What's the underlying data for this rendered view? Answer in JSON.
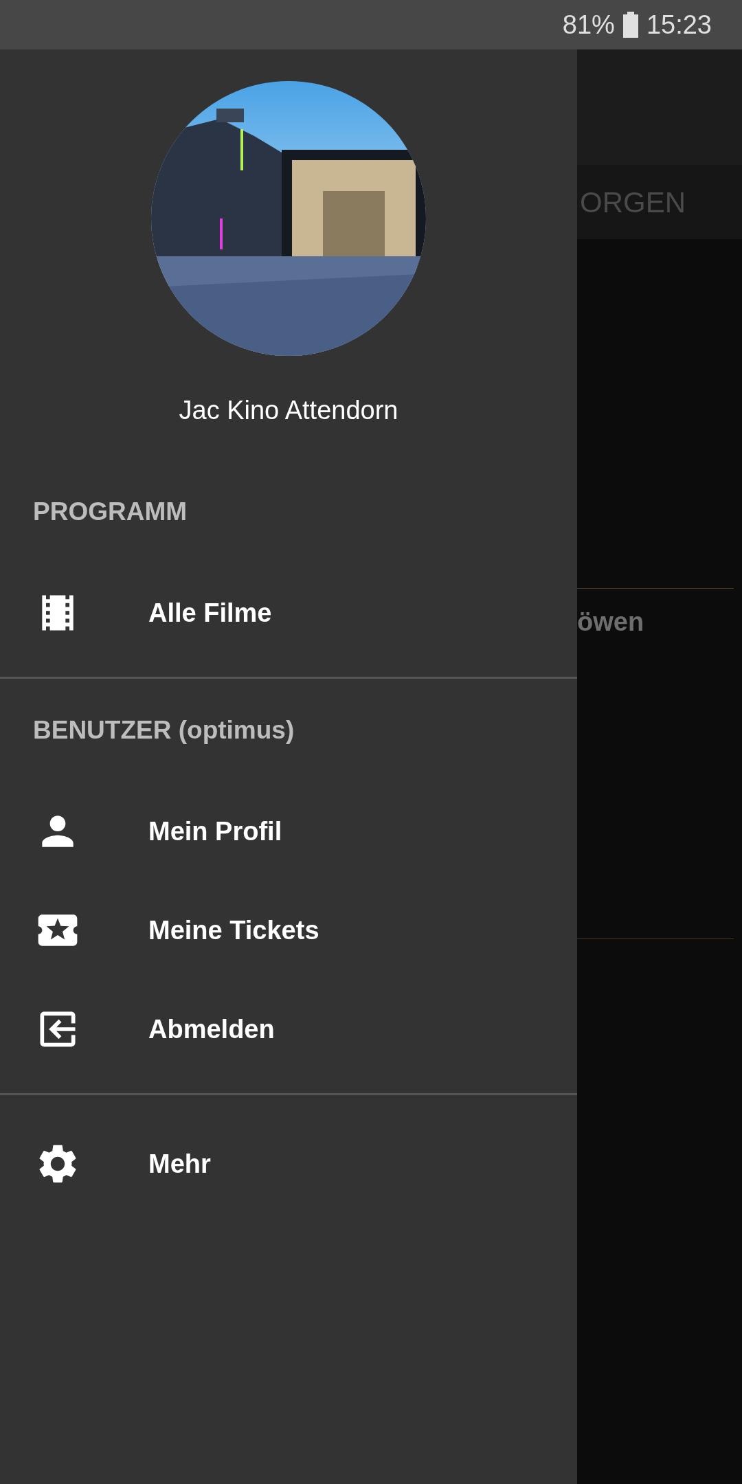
{
  "status_bar": {
    "battery": "81%",
    "time": "15:23"
  },
  "background": {
    "tab": "ORGEN",
    "rows": [
      {
        "title": "öwen"
      }
    ]
  },
  "drawer": {
    "header": {
      "name": "Jac Kino Attendorn"
    },
    "sections": [
      {
        "title": "PROGRAMM",
        "items": [
          {
            "label": "Alle Filme",
            "kind": "film"
          }
        ]
      },
      {
        "title": "BENUTZER (optimus)",
        "items": [
          {
            "label": "Mein Profil",
            "kind": "person"
          },
          {
            "label": "Meine Tickets",
            "kind": "ticket"
          },
          {
            "label": "Abmelden",
            "kind": "logout"
          }
        ]
      },
      {
        "items": [
          {
            "label": "Mehr",
            "kind": "settings"
          }
        ]
      }
    ]
  }
}
